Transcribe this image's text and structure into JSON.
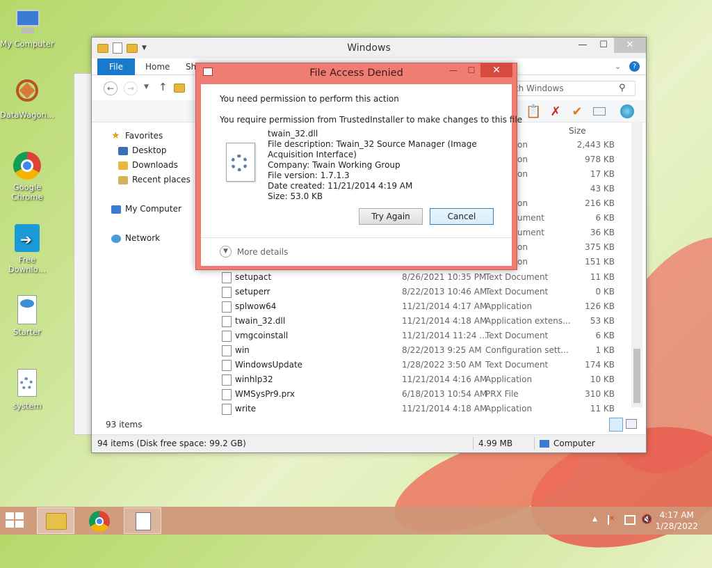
{
  "desktop": {
    "icons": [
      {
        "label": "My Computer",
        "icon": "my-computer-icon"
      },
      {
        "label": "DataWagon…",
        "icon": "datawagon-icon"
      },
      {
        "label": "Google Chrome",
        "icon": "chrome-icon"
      },
      {
        "label": "Free Downlo…",
        "icon": "free-download-icon"
      },
      {
        "label": "Starter",
        "icon": "starter-icon"
      },
      {
        "label": "system",
        "icon": "system-icon"
      }
    ]
  },
  "explorer": {
    "title": "Windows",
    "tabs": {
      "file": "File",
      "home": "Home",
      "share": "Sh"
    },
    "search_placeholder": "ch Windows",
    "nav": {
      "favorites": "Favorites",
      "desktop": "Desktop",
      "downloads": "Downloads",
      "recent": "Recent places",
      "my_computer": "My Computer",
      "network": "Network"
    },
    "column_size": "Size",
    "partial_rows": [
      {
        "type": "on",
        "size": "2,443 KB"
      },
      {
        "type": "on",
        "size": "978 KB"
      },
      {
        "type": "on",
        "size": "17 KB"
      },
      {
        "type": "",
        "size": "43 KB"
      },
      {
        "type": "on",
        "size": "216 KB"
      },
      {
        "type": "ument",
        "size": "6 KB"
      },
      {
        "type": "ument",
        "size": "36 KB"
      },
      {
        "type": "on",
        "size": "375 KB"
      },
      {
        "type": "on",
        "size": "151 KB"
      }
    ],
    "rows": [
      {
        "name": "setupact",
        "date": "8/26/2021 10:35 PM",
        "type": "Text Document",
        "size": "11 KB"
      },
      {
        "name": "setuperr",
        "date": "8/22/2013 10:46 AM",
        "type": "Text Document",
        "size": "0 KB"
      },
      {
        "name": "splwow64",
        "date": "11/21/2014 4:17 AM",
        "type": "Application",
        "size": "126 KB"
      },
      {
        "name": "twain_32.dll",
        "date": "11/21/2014 4:18 AM",
        "type": "Application extens...",
        "size": "53 KB"
      },
      {
        "name": "vmgcoinstall",
        "date": "11/21/2014 11:24 ...",
        "type": "Text Document",
        "size": "6 KB"
      },
      {
        "name": "win",
        "date": "8/22/2013 9:25 AM",
        "type": "Configuration sett...",
        "size": "1 KB"
      },
      {
        "name": "WindowsUpdate",
        "date": "1/28/2022 3:50 AM",
        "type": "Text Document",
        "size": "174 KB"
      },
      {
        "name": "winhlp32",
        "date": "11/21/2014 4:16 AM",
        "type": "Application",
        "size": "10 KB"
      },
      {
        "name": "WMSysPr9.prx",
        "date": "6/18/2013 10:54 AM",
        "type": "PRX File",
        "size": "310 KB"
      },
      {
        "name": "write",
        "date": "11/21/2014 4:18 AM",
        "type": "Application",
        "size": "11 KB"
      }
    ],
    "item_count": "93 items",
    "status": {
      "items": "94 items (Disk free space: 99.2 GB)",
      "size": "4.99 MB",
      "location": "Computer"
    }
  },
  "dialog": {
    "title": "File Access Denied",
    "line1": "You need permission to perform this action",
    "line2": "You require permission from TrustedInstaller to make changes to this file",
    "file_name": "twain_32.dll",
    "desc1": "File description: Twain_32 Source Manager (Image",
    "desc2": "Acquisition Interface)",
    "company": "Company: Twain Working Group",
    "version": "File version: 1.7.1.3",
    "created": "Date created: 11/21/2014 4:19 AM",
    "size": "Size: 53.0 KB",
    "try_again": "Try Again",
    "cancel": "Cancel",
    "more_details": "More details"
  },
  "taskbar": {
    "time": "4:17 AM",
    "date": "1/28/2022"
  },
  "colors": {
    "dialog_frame": "#ef7d74",
    "file_tab": "#1979ca",
    "taskbar": "#ce9678"
  }
}
